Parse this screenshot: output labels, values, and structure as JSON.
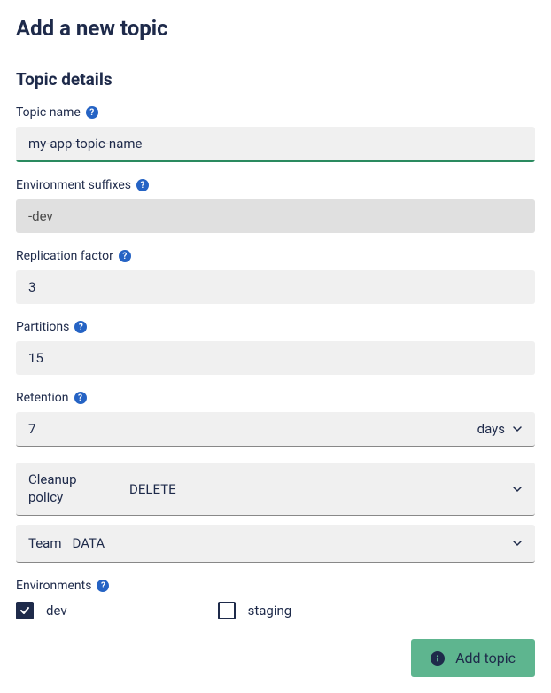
{
  "page": {
    "title": "Add a new topic",
    "section_title": "Topic details"
  },
  "fields": {
    "topic_name": {
      "label": "Topic name",
      "value": "my-app-topic-name"
    },
    "env_suffixes": {
      "label": "Environment suffixes",
      "value": "-dev"
    },
    "replication_factor": {
      "label": "Replication factor",
      "value": "3"
    },
    "partitions": {
      "label": "Partitions",
      "value": "15"
    },
    "retention": {
      "label": "Retention",
      "value": "7",
      "unit": "days"
    },
    "cleanup_policy": {
      "label": "Cleanup policy",
      "value": "DELETE"
    },
    "team": {
      "label": "Team",
      "value": "DATA"
    },
    "environments": {
      "label": "Environments",
      "options": [
        {
          "label": "dev",
          "checked": true
        },
        {
          "label": "staging",
          "checked": false
        }
      ]
    }
  },
  "actions": {
    "submit_label": "Add topic"
  }
}
